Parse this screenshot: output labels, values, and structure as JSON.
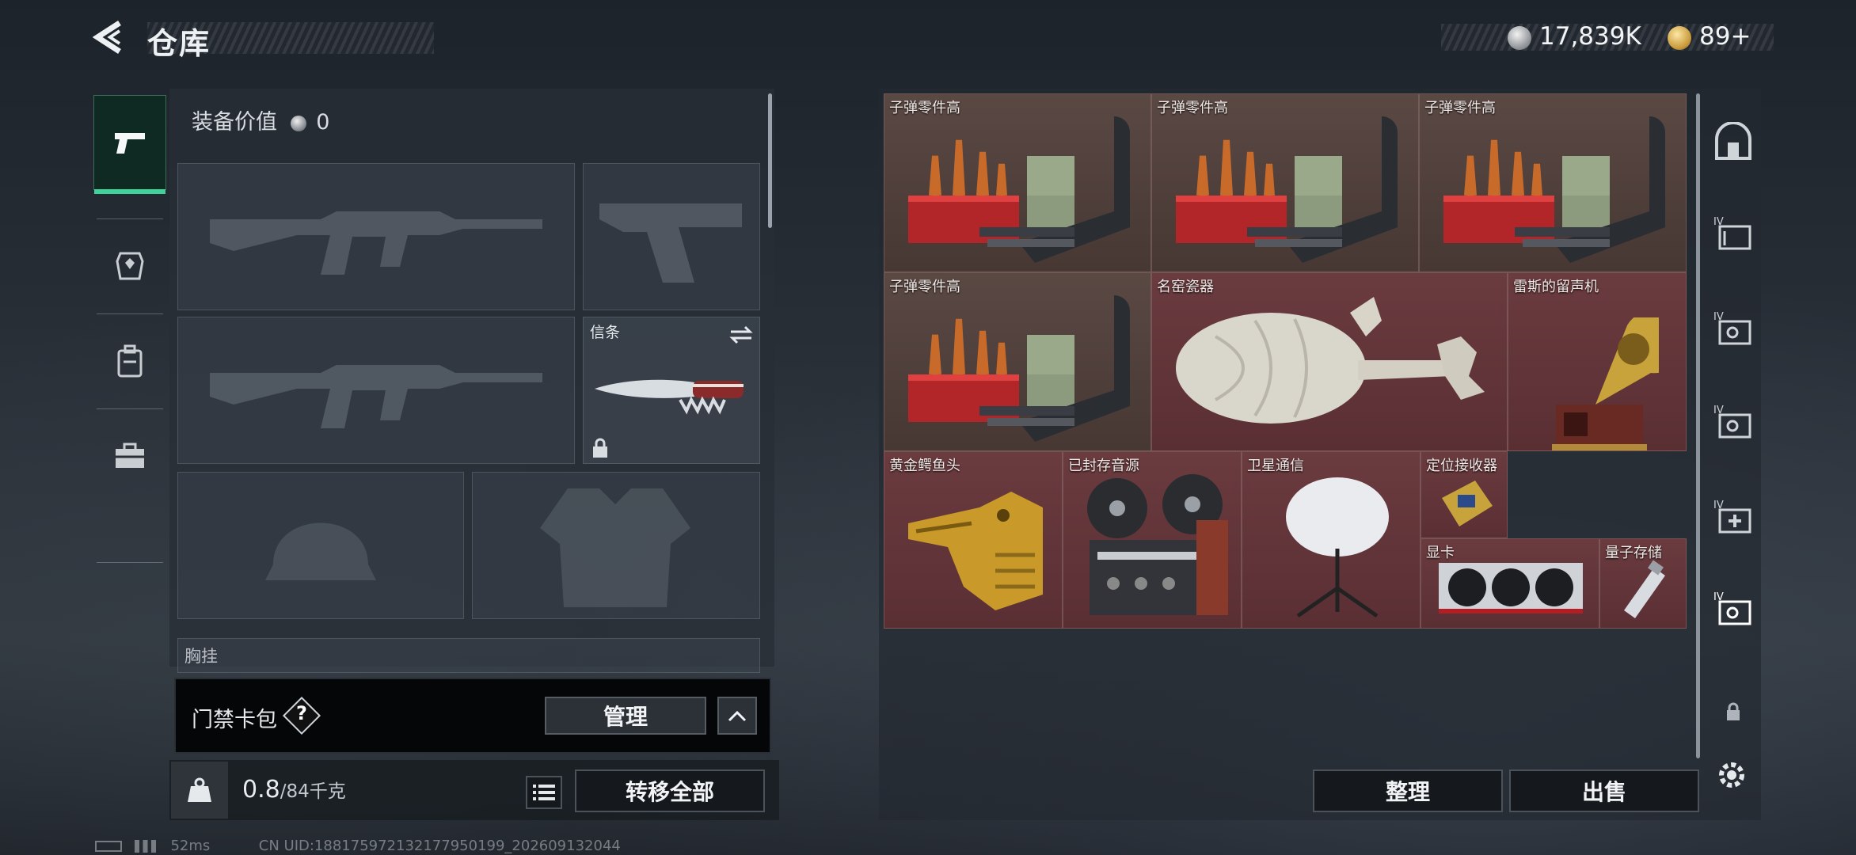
{
  "header": {
    "title": "仓库",
    "currency_silver": "17,839K",
    "currency_gold": "89+"
  },
  "left_panel": {
    "equip_value_label": "装备价值",
    "equip_value": "0",
    "melee_slot_label": "信条",
    "chest_rig_label": "胸挂"
  },
  "keycard": {
    "label": "门禁卡包",
    "help": "?",
    "manage_button": "管理"
  },
  "bottom_left": {
    "weight_current": "0.8",
    "weight_max": "/84千克",
    "transfer_all_button": "转移全部"
  },
  "grid_items": [
    {
      "name": "子弹零件高"
    },
    {
      "name": "子弹零件高"
    },
    {
      "name": "子弹零件高"
    },
    {
      "name": "子弹零件高"
    },
    {
      "name": "名窑瓷器"
    },
    {
      "name": "雷斯的留声机"
    },
    {
      "name": "黄金鳄鱼头"
    },
    {
      "name": "已封存音源"
    },
    {
      "name": "卫星通信"
    },
    {
      "name": "定位接收器"
    },
    {
      "name": "显卡"
    },
    {
      "name": "量子存储"
    }
  ],
  "actions": {
    "organize_button": "整理",
    "sell_button": "出售"
  },
  "status_bar": {
    "ping": "52ms",
    "uid": "CN UID:188175972132177950199_202609132044"
  },
  "colors": {
    "accent_green": "#3fd39a",
    "cell_red": "#6a3b3f",
    "cell_brown": "#5a4843"
  },
  "icons": [
    "back-arrow-icon",
    "pistol-icon",
    "armor-icon",
    "backpack-icon",
    "briefcase-icon",
    "safe-icon",
    "settings-icon",
    "lock-icon"
  ]
}
